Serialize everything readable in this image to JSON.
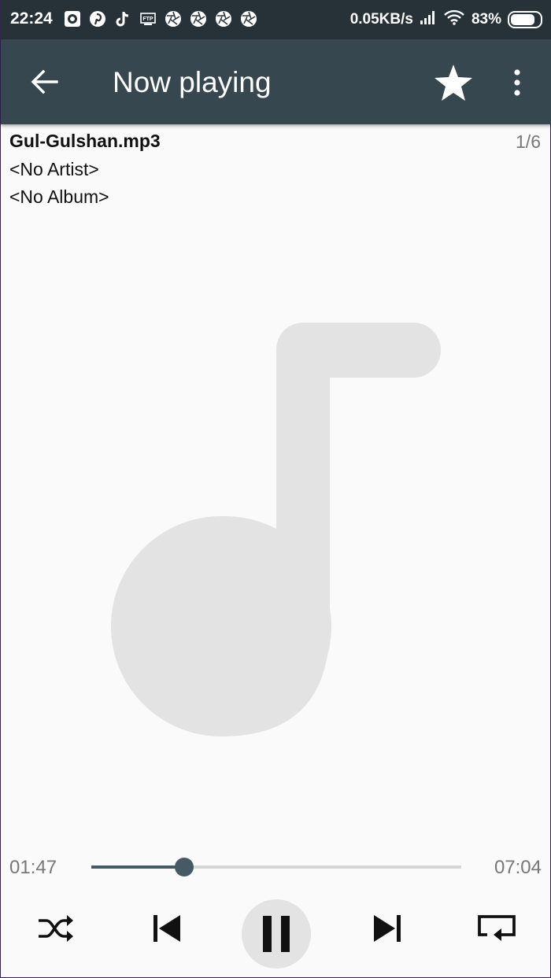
{
  "status_bar": {
    "time": "22:24",
    "net_speed": "0.05KB/s",
    "battery_percent": "83%",
    "battery_level": 0.83,
    "notification_icons": [
      "camera-icon",
      "pinterest-icon",
      "tiktok-icon",
      "ftp-icon",
      "aperture-icon",
      "aperture-icon",
      "aperture-icon",
      "aperture-icon"
    ]
  },
  "app_bar": {
    "title": "Now playing",
    "back_icon": "arrow-back-icon",
    "favorite_icon": "star-icon",
    "menu_icon": "more-vert-icon"
  },
  "track": {
    "title": "Gul-Gulshan.mp3",
    "index": "1/6",
    "artist": "<No Artist>",
    "album": "<No Album>",
    "art_icon": "music-note-icon"
  },
  "playback": {
    "elapsed": "01:47",
    "total": "07:04",
    "progress": 0.25
  },
  "controls": {
    "shuffle_icon": "shuffle-icon",
    "previous_icon": "skip-previous-icon",
    "play_pause_icon": "pause-icon",
    "next_icon": "skip-next-icon",
    "repeat_icon": "repeat-icon"
  },
  "colors": {
    "status_bar": "#263238",
    "app_bar": "#37474f",
    "accent": "#455a64",
    "background": "#fafafa",
    "album_art": "#e3e3e3"
  }
}
